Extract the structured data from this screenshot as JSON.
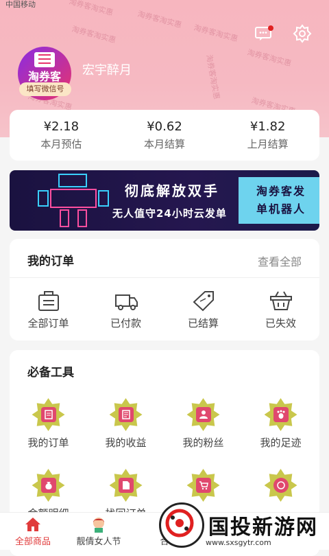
{
  "statusbar": {
    "carrier": "中国移动"
  },
  "watermarks": [
    "淘券客淘实惠",
    "淘券客淘实惠",
    "淘券客淘实惠",
    "淘券客淘实惠",
    "淘券客淘实惠",
    "淘券客淘实惠",
    "淘券客淘实惠",
    "淘券客淘实惠"
  ],
  "profile": {
    "avatar_text": "淘券客",
    "avatar_badge": "填写微信号",
    "username": "宏宇醉月"
  },
  "icons": {
    "message": "message-icon",
    "settings": "gear-icon"
  },
  "earnings": [
    {
      "value": "¥2.18",
      "label": "本月预估"
    },
    {
      "value": "¥0.62",
      "label": "本月结算"
    },
    {
      "value": "¥1.82",
      "label": "上月结算"
    }
  ],
  "banner": {
    "title": "彻底解放双手",
    "subtitle": "无人值守24小时云发单",
    "box_line1": "淘券客发",
    "box_line2": "单机器人"
  },
  "orders": {
    "title": "我的订单",
    "more": "查看全部",
    "items": [
      {
        "label": "全部订单",
        "icon": "orders-list-icon"
      },
      {
        "label": "已付款",
        "icon": "delivery-truck-icon"
      },
      {
        "label": "已结算",
        "icon": "sale-tag-icon"
      },
      {
        "label": "已失效",
        "icon": "basket-icon"
      }
    ]
  },
  "tools": {
    "title": "必备工具",
    "items": [
      {
        "label": "我的订单",
        "icon": "order-icon"
      },
      {
        "label": "我的收益",
        "icon": "income-icon"
      },
      {
        "label": "我的粉丝",
        "icon": "fans-icon"
      },
      {
        "label": "我的足迹",
        "icon": "footprint-icon"
      },
      {
        "label": "金额明细",
        "icon": "money-bag-icon"
      },
      {
        "label": "找回订单",
        "icon": "document-icon"
      },
      {
        "label": "",
        "icon": "cart-icon"
      },
      {
        "label": "",
        "icon": "sign-in-icon"
      }
    ]
  },
  "tabbar": [
    {
      "label": "全部商品",
      "icon": "home-icon",
      "active": true
    },
    {
      "label": "靓倩女人节",
      "icon": "girl-icon",
      "active": false
    },
    {
      "label": "合",
      "icon": "",
      "active": false
    }
  ],
  "site_watermark": {
    "name": "国投新游网",
    "url": "www.sxsgytr.com"
  },
  "colors": {
    "header": "#f7b6bf",
    "accent": "#e03a3a",
    "tool_star": "#c9c74c",
    "tool_inner": "#e0486e",
    "banner_box": "#6ed3ee"
  }
}
